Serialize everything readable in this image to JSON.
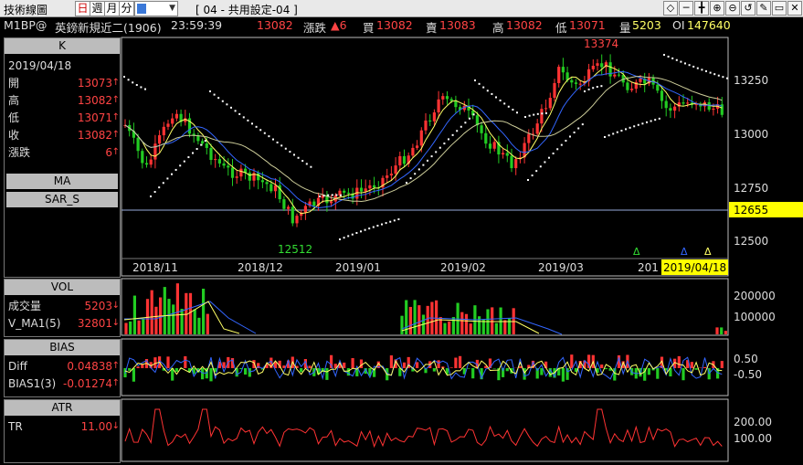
{
  "toolbar": {
    "title": "技術線圖",
    "periods": [
      "日",
      "週",
      "月",
      "分"
    ],
    "selected_period": "日",
    "dropdown_value": "",
    "layout_label": "[ 04 - 共用設定-04 ]",
    "buttons": [
      "◇",
      "─",
      "╋",
      "⊕",
      "⊖",
      "↺",
      "✎",
      "▭",
      "✕"
    ]
  },
  "info": {
    "symbol": "M1BP@",
    "name": "英鎊新規近二(1906)",
    "time": "23:59:39",
    "last": "13082",
    "change_label": "漲跌",
    "change": "▲6",
    "bid_label": "買",
    "bid": "13082",
    "ask_label": "賣",
    "ask": "13083",
    "high_label": "高",
    "high": "13082",
    "low_label": "低",
    "low": "13071",
    "vol_label": "量",
    "vol": "5203",
    "oi_label": "OI",
    "oi": "147640"
  },
  "k_panel": {
    "header": "K",
    "date": "2019/04/18",
    "rows": [
      {
        "label": "開",
        "value": "13073"
      },
      {
        "label": "高",
        "value": "13082"
      },
      {
        "label": "低",
        "value": "13071"
      },
      {
        "label": "收",
        "value": "13082"
      },
      {
        "label": "漲跌",
        "value": "6"
      }
    ],
    "indicators": [
      "MA",
      "SAR_S"
    ]
  },
  "vol_panel": {
    "header": "VOL",
    "rows": [
      {
        "label": "成交量",
        "value": "5203"
      },
      {
        "label": "V_MA1(5)",
        "value": "32801"
      }
    ]
  },
  "bias_panel": {
    "header": "BIAS",
    "rows": [
      {
        "label": "Diff",
        "value": "0.04838"
      },
      {
        "label": "BIAS1(3)",
        "value": "-0.01274"
      }
    ]
  },
  "atr_panel": {
    "header": "ATR",
    "rows": [
      {
        "label": "TR",
        "value": "11.00"
      }
    ]
  },
  "price_axis": {
    "ticks": [
      "13250",
      "13000",
      "12750",
      "12500"
    ],
    "current_level": "12655",
    "max_label": "13374",
    "min_label": "12512"
  },
  "date_axis": {
    "labels": [
      "2018/11",
      "2018/12",
      "2019/01",
      "2019/02",
      "2019/03",
      "201"
    ],
    "current_date": "2019/04/18"
  },
  "vol_axis": {
    "ticks": [
      "200000",
      "100000"
    ]
  },
  "bias_axis": {
    "ticks": [
      "0.50",
      "-0.50"
    ]
  },
  "atr_axis": {
    "ticks": [
      "200.00",
      "100.00"
    ]
  },
  "colors": {
    "up": "#ff3333",
    "down": "#22cc22",
    "sar": "#ffffff",
    "ma_short": "#ffff66",
    "ma_mid": "#3366ff",
    "ma_long": "#cccc99",
    "highlight": "#ffff00"
  }
}
